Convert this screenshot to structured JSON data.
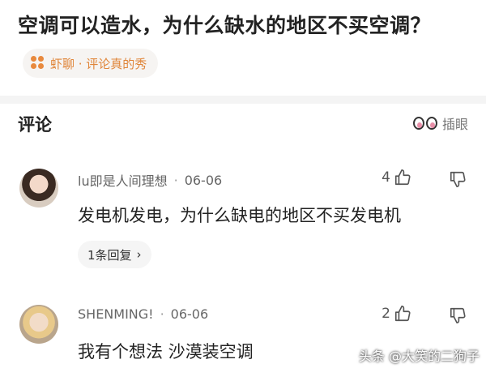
{
  "question": "空调可以造水，为什么缺水的地区不买空调？",
  "source": {
    "label": "虾聊 · 评论真的秀",
    "accent": "#e8893d"
  },
  "comments_header": {
    "title": "评论",
    "peek_label": "插眼"
  },
  "comments": [
    {
      "username": "lu即是人间理想",
      "date": "06-06",
      "likes": "4",
      "text": "发电机发电，为什么缺电的地区不买发电机",
      "reply_label": "1条回复"
    },
    {
      "username": "SHENMING!",
      "date": "06-06",
      "likes": "2",
      "text": "我有个想法 沙漠装空调"
    }
  ],
  "watermark": "头条 @大笑的二狗子"
}
